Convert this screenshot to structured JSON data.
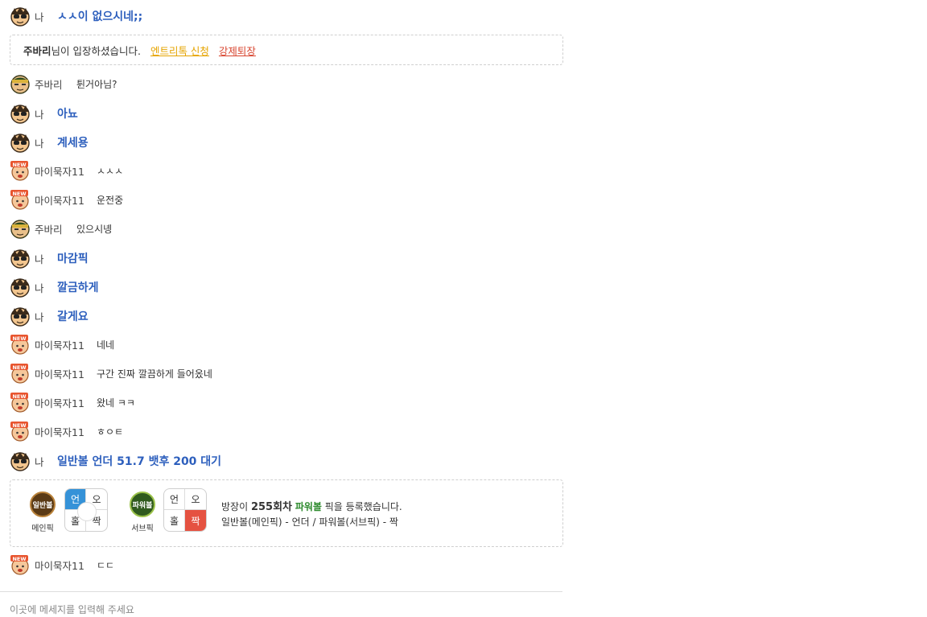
{
  "icons": {
    "me": "sunglasses-avatar-icon",
    "jubari": "headband-avatar-icon",
    "new": "new-user-avatar-icon"
  },
  "messages_top": [
    {
      "nick": "나",
      "text": "ㅅㅅ이 없으시네;;",
      "me": true,
      "avatar": "me"
    }
  ],
  "system": {
    "user": "주바리",
    "text": "님이 입장하셨습니다.",
    "entry_link": "엔트리톡 신청",
    "kick_link": "강제퇴장"
  },
  "messages": [
    {
      "nick": "주바리",
      "text": "튄거아님?",
      "me": false,
      "avatar": "jubari"
    },
    {
      "nick": "나",
      "text": "아뇨",
      "me": true,
      "avatar": "me"
    },
    {
      "nick": "나",
      "text": "계세용",
      "me": true,
      "avatar": "me"
    },
    {
      "nick": "마이묵자11",
      "text": "ㅅㅅㅅ",
      "me": false,
      "avatar": "new"
    },
    {
      "nick": "마이묵자11",
      "text": "운전중",
      "me": false,
      "avatar": "new"
    },
    {
      "nick": "주바리",
      "text": "있으시녱",
      "me": false,
      "avatar": "jubari"
    },
    {
      "nick": "나",
      "text": "마감픽",
      "me": true,
      "avatar": "me"
    },
    {
      "nick": "나",
      "text": "깔금하게",
      "me": true,
      "avatar": "me"
    },
    {
      "nick": "나",
      "text": "갈게요",
      "me": true,
      "avatar": "me"
    },
    {
      "nick": "마이묵자11",
      "text": "네네",
      "me": false,
      "avatar": "new"
    },
    {
      "nick": "마이묵자11",
      "text": "구간 진짜 깔끔하게 들어옸네",
      "me": false,
      "avatar": "new"
    },
    {
      "nick": "마이묵자11",
      "text": "왔네 ㅋㅋ",
      "me": false,
      "avatar": "new"
    },
    {
      "nick": "마이묵자11",
      "text": "ㅎㅇㅌ",
      "me": false,
      "avatar": "new"
    },
    {
      "nick": "나",
      "text": "일반볼 언더 51.7 뱃후 200 대기",
      "me": true,
      "avatar": "me"
    }
  ],
  "pick": {
    "main_ball": "일반볼",
    "main_label": "메인픽",
    "sub_ball": "파워볼",
    "sub_label": "서브픽",
    "main_cells": [
      "언",
      "오",
      "홀",
      "짝"
    ],
    "sub_cells": [
      "언",
      "오",
      "홀",
      "짝"
    ],
    "info_prefix": "방장이 ",
    "round": "255회차",
    "game": "파워볼",
    "info_suffix": " 픽을 등록했습니다.",
    "summary": "일반볼(메인픽) - 언더 / 파워볼(서브픽) - 짝",
    "main_selected": "언",
    "sub_selected": "짝"
  },
  "last_message": {
    "nick": "마이묵자11",
    "text": "ㄷㄷ",
    "me": false,
    "avatar": "new"
  },
  "input": {
    "placeholder": "이곳에 메세지를 입력해 주세요"
  }
}
